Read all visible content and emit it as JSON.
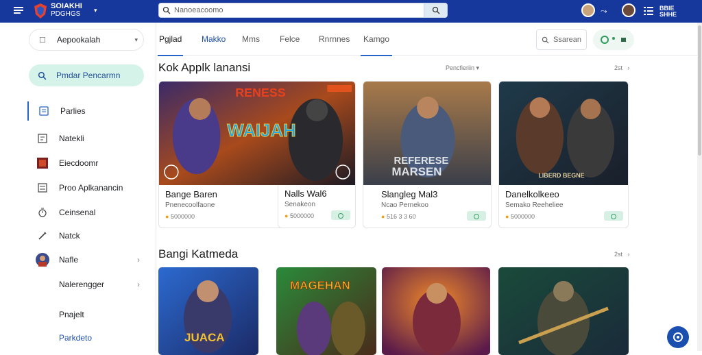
{
  "topbar": {
    "brand_line1": "SOIAKHI",
    "brand_line2": "PDGHGS",
    "search": {
      "value": "Nanoeacoomo",
      "placeholder": ""
    },
    "right_text_line1": "BBIE",
    "right_text_line2": "SHHE"
  },
  "sidebar": {
    "select_label": "Aepookalah",
    "search_label": "Pmdar Pencarmn",
    "items": [
      {
        "label": "Parlies",
        "icon": "page-icon"
      },
      {
        "label": "Natekli",
        "icon": "doc-icon"
      },
      {
        "label": "Eiecdoomr",
        "icon": "tile-icon"
      },
      {
        "label": "Proo Aplkanancin",
        "icon": "list-icon"
      },
      {
        "label": "Ceinsenal",
        "icon": "timer-icon"
      },
      {
        "label": "Natck",
        "icon": "pen-icon"
      },
      {
        "label": "Nafle",
        "icon": "avatar-icon"
      },
      {
        "label": "Nalerengger",
        "icon": ""
      },
      {
        "label": "Pnajelt",
        "icon": ""
      },
      {
        "label": "Parkdeto",
        "icon": ""
      }
    ]
  },
  "tabs": [
    {
      "label": "Pgjlad"
    },
    {
      "label": "Makko"
    },
    {
      "label": "Mms"
    },
    {
      "label": "Felce"
    },
    {
      "label": "Rnrnnes"
    },
    {
      "label": "Kamgo"
    }
  ],
  "toolbar": {
    "search_label": "Ssarean"
  },
  "section1": {
    "title": "Kok Applk lanansi",
    "sort_label": "Pencfieriin",
    "pager": "2st",
    "cards": [
      {
        "name": "Bange Baren",
        "sub": "Pnenecoolfaone",
        "price": "5000000",
        "img_text1": "RENESS",
        "img_text2": "WAIJAH"
      },
      {
        "name": "Nalls Wal6",
        "sub": "Senakeon",
        "price": "5000000",
        "img_text1": "",
        "img_text2": ""
      },
      {
        "name": "Slangleg Mal3",
        "sub": "Ncao Pernekoo",
        "price": "516 3 3 60",
        "img_text1": "REFERESE",
        "img_text2": "MARSEN"
      },
      {
        "name": "Danelkolkeeo",
        "sub": "Semako Reeheliee",
        "price": "5000000",
        "img_text1": "LIBERD BEGNE",
        "img_text2": ""
      }
    ]
  },
  "section2": {
    "title": "Bangi Katmeda",
    "pager": "2st",
    "cards": [
      {
        "img_text": "JUACA"
      },
      {
        "img_text": "MAGEHAN"
      },
      {
        "img_text": ""
      },
      {
        "img_text": ""
      }
    ]
  },
  "colors": {
    "topbar": "#16379c",
    "accent": "#2563c9",
    "sidebar_search_bg": "#d6f3ea",
    "badge_bg": "#d7f0e4"
  }
}
